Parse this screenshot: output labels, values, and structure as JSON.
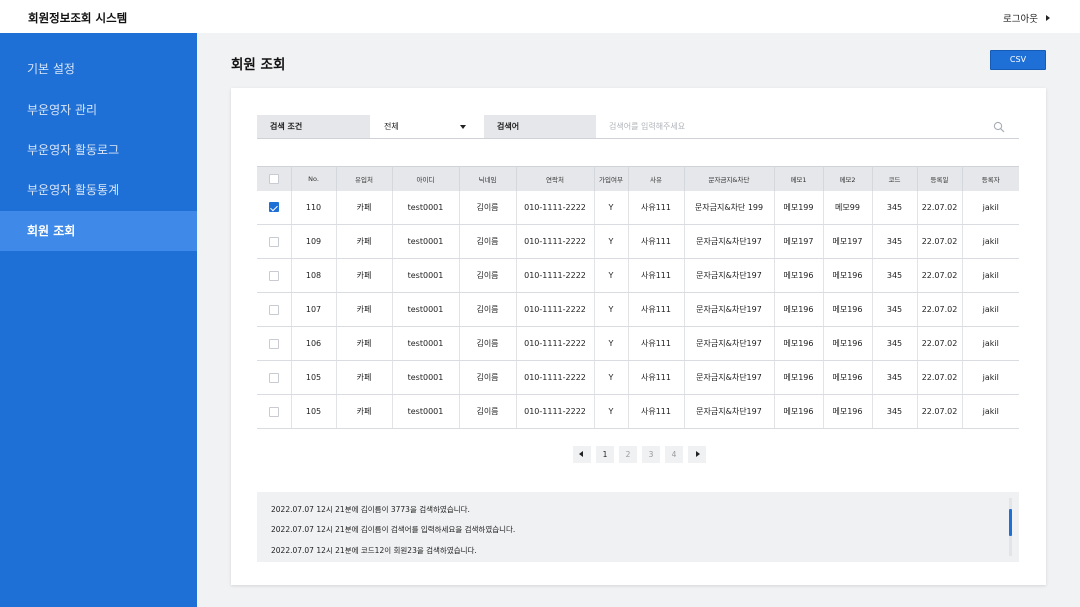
{
  "app": {
    "title": "회원정보조회 시스템",
    "logout_label": "로그아웃"
  },
  "sidebar": {
    "items": [
      {
        "label": "기본 설정"
      },
      {
        "label": "부운영자 관리"
      },
      {
        "label": "부운영자 활동로그"
      },
      {
        "label": "부운영자 활동통계"
      },
      {
        "label": "회원 조회",
        "active": true
      }
    ]
  },
  "page": {
    "title": "회원 조회",
    "csv_label": "CSV"
  },
  "search": {
    "condition_label": "검색 조건",
    "condition_value": "전체",
    "keyword_label": "검색어",
    "placeholder": "검색어를 입력해주세요"
  },
  "table": {
    "headers": [
      "No.",
      "유입처",
      "아이디",
      "닉네임",
      "연락처",
      "가입여부",
      "사유",
      "문자금지&차단",
      "메모1",
      "메모2",
      "코드",
      "등록일",
      "등록자"
    ],
    "rows": [
      {
        "checked": true,
        "cells": [
          "110",
          "카페",
          "test0001",
          "김이름",
          "010-1111-2222",
          "Y",
          "사유111",
          "문자금지&차단 199",
          "메모199",
          "메모99",
          "345",
          "22.07.02",
          "jakil"
        ]
      },
      {
        "checked": false,
        "cells": [
          "109",
          "카페",
          "test0001",
          "김이름",
          "010-1111-2222",
          "Y",
          "사유111",
          "문자금지&차단197",
          "메모197",
          "메모197",
          "345",
          "22.07.02",
          "jakil"
        ]
      },
      {
        "checked": false,
        "cells": [
          "108",
          "카페",
          "test0001",
          "김이름",
          "010-1111-2222",
          "Y",
          "사유111",
          "문자금지&차단197",
          "메모196",
          "메모196",
          "345",
          "22.07.02",
          "jakil"
        ]
      },
      {
        "checked": false,
        "cells": [
          "107",
          "카페",
          "test0001",
          "김이름",
          "010-1111-2222",
          "Y",
          "사유111",
          "문자금지&차단197",
          "메모196",
          "메모196",
          "345",
          "22.07.02",
          "jakil"
        ]
      },
      {
        "checked": false,
        "cells": [
          "106",
          "카페",
          "test0001",
          "김이름",
          "010-1111-2222",
          "Y",
          "사유111",
          "문자금지&차단197",
          "메모196",
          "메모196",
          "345",
          "22.07.02",
          "jakil"
        ]
      },
      {
        "checked": false,
        "cells": [
          "105",
          "카페",
          "test0001",
          "김이름",
          "010-1111-2222",
          "Y",
          "사유111",
          "문자금지&차단197",
          "메모196",
          "메모196",
          "345",
          "22.07.02",
          "jakil"
        ]
      },
      {
        "checked": false,
        "cells": [
          "105",
          "카페",
          "test0001",
          "김이름",
          "010-1111-2222",
          "Y",
          "사유111",
          "문자금지&차단197",
          "메모196",
          "메모196",
          "345",
          "22.07.02",
          "jakil"
        ]
      }
    ]
  },
  "pagination": {
    "pages": [
      "1",
      "2",
      "3",
      "4"
    ],
    "current": "1"
  },
  "log": {
    "lines": [
      "2022.07.07 12시 21분에 김이름이 3773을 검색하였습니다.",
      "2022.07.07 12시 21분에 김이름이 검색어를 입력하세요을 검색하였습니다.",
      "2022.07.07 12시 21분에 코드12이 회원23을 검색하였습니다."
    ]
  },
  "colors": {
    "primary": "#1e6fd6",
    "sidebar_active": "#3f8ae8",
    "header_bg": "#e6e7ea"
  }
}
